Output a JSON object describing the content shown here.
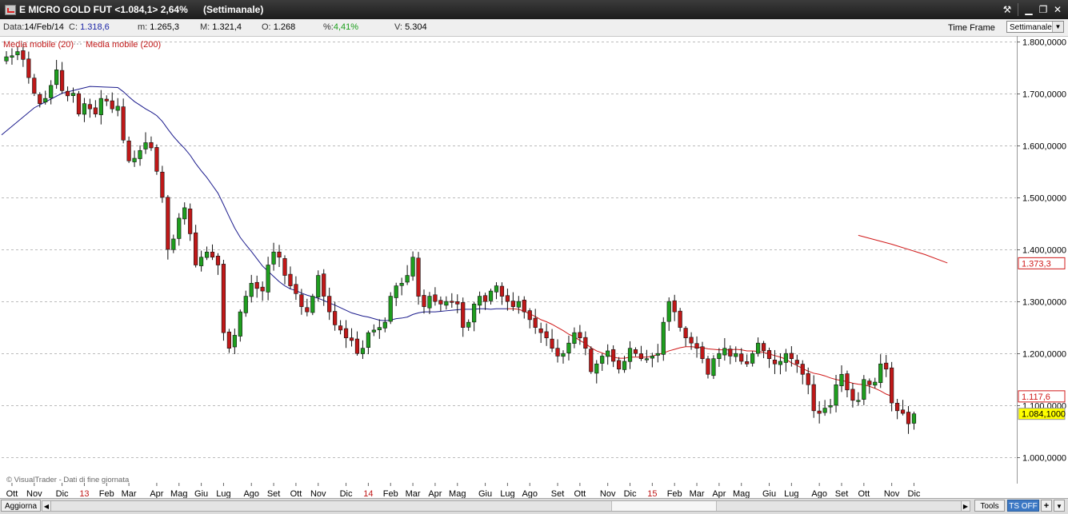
{
  "window": {
    "title": "E MICRO GOLD FUT <1.084,1> 2,64%",
    "subtitle": "(Settimanale)",
    "icons": [
      "tool-icon",
      "minimize-icon",
      "restore-icon",
      "close-icon"
    ],
    "tool_glyph": "⚒",
    "min_glyph": "▁",
    "restore_glyph": "❐",
    "close_glyph": "✕"
  },
  "info": {
    "data_label": "Data:",
    "data_value": "14/Feb/14",
    "c_label": "C:",
    "c_value": "1.318,6",
    "m_label": "m:",
    "m_value": "1.265,3",
    "M_label": "M:",
    "M_value": "1.321,4",
    "o_label": "O:",
    "o_value": "1.268",
    "pct_label": "%:",
    "pct_value": "4,41%",
    "v_label": "V:",
    "v_value": "5.304",
    "timeframe_label": "Time Frame",
    "timeframe_value": "Settimanale",
    "timeframe_arrow": "▼"
  },
  "footer": {
    "update_label": "Aggiorna",
    "tools_label": "Tools",
    "ts_label": "TS OFF",
    "plus_label": "+",
    "menu_arrow": "▼",
    "left_arrow": "◀",
    "right_arrow": "▶"
  },
  "colors": {
    "up": "#1e9e1e",
    "down": "#c01818",
    "ma20": "#1a1a8c",
    "ma200": "#d01818",
    "grid": "#bbbbbb",
    "price_box": "#ffff00"
  },
  "chart_data": {
    "type": "candlestick",
    "ylim": [
      950,
      1810
    ],
    "y_ticks": [
      1000,
      1100,
      1200,
      1300,
      1400,
      1500,
      1600,
      1700,
      1800
    ],
    "y_tick_labels": [
      "1.000,0000",
      "1.100,0000",
      "1.200,0000",
      "1.300,0000",
      "1.400,0000",
      "1.500,0000",
      "1.600,0000",
      "1.700,0000",
      "1.800,0000"
    ],
    "legend": [
      {
        "name": "Media mobile (20)",
        "color": "#c01818"
      },
      {
        "name": "Media mobile (200)",
        "color": "#c01818"
      }
    ],
    "watermark": "© VisualTrader - Dati di fine giornata",
    "price_labels": [
      {
        "value": 1373.3,
        "text": "1.373,3",
        "style": "ma"
      },
      {
        "value": 1117.6,
        "text": "1.117,6",
        "style": "ma"
      },
      {
        "value": 1084.1,
        "text": "1.084,1000",
        "style": "last"
      }
    ],
    "x_labels": [
      {
        "bar": 1,
        "text": "Ott"
      },
      {
        "bar": 5,
        "text": "Nov"
      },
      {
        "bar": 10,
        "text": "Dic"
      },
      {
        "bar": 14,
        "text": "13",
        "year": true
      },
      {
        "bar": 18,
        "text": "Feb"
      },
      {
        "bar": 22,
        "text": "Mar"
      },
      {
        "bar": 27,
        "text": "Apr"
      },
      {
        "bar": 31,
        "text": "Mag"
      },
      {
        "bar": 35,
        "text": "Giu"
      },
      {
        "bar": 39,
        "text": "Lug"
      },
      {
        "bar": 44,
        "text": "Ago"
      },
      {
        "bar": 48,
        "text": "Set"
      },
      {
        "bar": 52,
        "text": "Ott"
      },
      {
        "bar": 56,
        "text": "Nov"
      },
      {
        "bar": 61,
        "text": "Dic"
      },
      {
        "bar": 65,
        "text": "14",
        "year": true
      },
      {
        "bar": 69,
        "text": "Feb"
      },
      {
        "bar": 73,
        "text": "Mar"
      },
      {
        "bar": 77,
        "text": "Apr"
      },
      {
        "bar": 81,
        "text": "Mag"
      },
      {
        "bar": 86,
        "text": "Giu"
      },
      {
        "bar": 90,
        "text": "Lug"
      },
      {
        "bar": 94,
        "text": "Ago"
      },
      {
        "bar": 99,
        "text": "Set"
      },
      {
        "bar": 103,
        "text": "Ott"
      },
      {
        "bar": 108,
        "text": "Nov"
      },
      {
        "bar": 112,
        "text": "Dic"
      },
      {
        "bar": 116,
        "text": "15",
        "year": true
      },
      {
        "bar": 120,
        "text": "Feb"
      },
      {
        "bar": 124,
        "text": "Mar"
      },
      {
        "bar": 128,
        "text": "Apr"
      },
      {
        "bar": 132,
        "text": "Mag"
      },
      {
        "bar": 137,
        "text": "Giu"
      },
      {
        "bar": 141,
        "text": "Lug"
      },
      {
        "bar": 146,
        "text": "Ago"
      },
      {
        "bar": 150,
        "text": "Set"
      },
      {
        "bar": 154,
        "text": "Ott"
      },
      {
        "bar": 159,
        "text": "Nov"
      },
      {
        "bar": 163,
        "text": "Dic"
      }
    ],
    "close": [
      1770,
      1772,
      1780,
      1765,
      1730,
      1700,
      1680,
      1690,
      1715,
      1745,
      1705,
      1695,
      1700,
      1660,
      1680,
      1670,
      1660,
      1690,
      1685,
      1670,
      1675,
      1610,
      1570,
      1575,
      1590,
      1605,
      1595,
      1550,
      1500,
      1400,
      1420,
      1460,
      1480,
      1430,
      1370,
      1385,
      1395,
      1385,
      1370,
      1240,
      1210,
      1235,
      1280,
      1310,
      1335,
      1325,
      1320,
      1370,
      1395,
      1385,
      1350,
      1330,
      1315,
      1290,
      1280,
      1310,
      1350,
      1310,
      1280,
      1255,
      1245,
      1230,
      1225,
      1200,
      1210,
      1240,
      1245,
      1250,
      1260,
      1310,
      1330,
      1335,
      1350,
      1385,
      1310,
      1290,
      1310,
      1300,
      1295,
      1300,
      1300,
      1295,
      1250,
      1260,
      1295,
      1310,
      1300,
      1320,
      1330,
      1310,
      1300,
      1290,
      1300,
      1280,
      1265,
      1250,
      1240,
      1230,
      1210,
      1195,
      1200,
      1220,
      1240,
      1230,
      1210,
      1165,
      1180,
      1195,
      1205,
      1185,
      1170,
      1185,
      1210,
      1200,
      1190,
      1190,
      1195,
      1200,
      1260,
      1300,
      1280,
      1250,
      1230,
      1220,
      1210,
      1190,
      1160,
      1190,
      1200,
      1210,
      1195,
      1200,
      1185,
      1180,
      1200,
      1220,
      1205,
      1190,
      1180,
      1185,
      1200,
      1190,
      1180,
      1160,
      1140,
      1090,
      1085,
      1095,
      1100,
      1140,
      1160,
      1130,
      1110,
      1110,
      1150,
      1140,
      1145,
      1180,
      1170,
      1105,
      1090,
      1085,
      1065,
      1084.1
    ],
    "ma20": [
      null,
      null,
      null,
      null,
      null,
      null,
      null,
      null,
      null,
      null,
      null,
      null,
      null,
      null,
      null,
      null,
      null,
      null,
      null,
      null,
      1711,
      1703,
      1693,
      1684,
      1677,
      1670,
      1664,
      1657,
      1646,
      1631,
      1617,
      1605,
      1594,
      1581,
      1565,
      1551,
      1538,
      1523,
      1508,
      1486,
      1463,
      1441,
      1423,
      1409,
      1396,
      1382,
      1368,
      1358,
      1348,
      1338,
      1330,
      1324,
      1321,
      1316,
      1312,
      1309,
      1306,
      1302,
      1297,
      1293,
      1288,
      1283,
      1278,
      1275,
      1272,
      1270,
      1267,
      1264,
      1263,
      1264,
      1267,
      1268,
      1270,
      1275,
      1278,
      1280,
      1280,
      1280,
      1281,
      1282,
      1283,
      1284,
      1285,
      1285,
      1285,
      1286,
      1286,
      1285,
      1286,
      1286,
      1286,
      1286,
      1285,
      1281,
      1276,
      1271,
      1265,
      1261,
      1256,
      1250,
      1244,
      1237,
      1232,
      1225,
      1219,
      1211,
      1205,
      1201,
      1197,
      1193,
      1191,
      1191,
      1193,
      1193,
      1193,
      1193,
      1195,
      1198,
      1201,
      1205,
      1208,
      1211,
      1213,
      1213,
      1212,
      1211,
      1209,
      1208,
      1207,
      1207,
      1207,
      1208,
      1207,
      1205,
      1205,
      1204,
      1202,
      1199,
      1196,
      1193,
      1189,
      1182,
      1177,
      1171,
      1166,
      1162,
      1160,
      1157,
      1153,
      1150,
      1148,
      1146,
      1143,
      1141,
      1140,
      1137,
      1133,
      1128,
      1122,
      1118
    ],
    "ma200_points": [
      {
        "bar": 153,
        "value": 1427
      },
      {
        "bar": 159,
        "value": 1410
      },
      {
        "bar": 165,
        "value": 1390
      },
      {
        "bar": 169,
        "value": 1374
      }
    ]
  }
}
